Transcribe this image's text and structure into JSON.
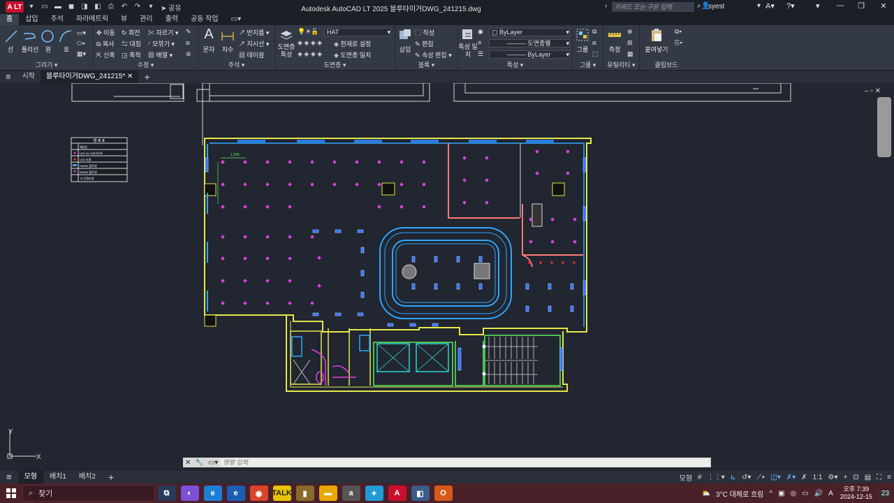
{
  "titlebar": {
    "logo_text": "A LT",
    "share_label": "공유",
    "title": "Autodesk AutoCAD LT 2025   블루타이거DWG_241215.dwg",
    "search_placeholder": "키워드 또는 구문 입력",
    "user": "syest"
  },
  "ribbon_tabs": [
    "홈",
    "삽입",
    "주석",
    "파라메트릭",
    "뷰",
    "관리",
    "출력",
    "공동 작업"
  ],
  "ribbon": {
    "draw": {
      "title": "그리기",
      "line": "선",
      "polyline": "폴리선",
      "circle": "원",
      "arc": "호"
    },
    "modify": {
      "title": "수정",
      "move": "이동",
      "rotate": "회전",
      "trim": "자르기",
      "copy": "복사",
      "mirror": "대칭",
      "fillet": "모깎기",
      "stretch": "신축",
      "scale": "축척",
      "array": "배열"
    },
    "annotation": {
      "title": "주석",
      "text": "문자",
      "dimension": "치수",
      "leader": "지시선",
      "multileader": "반지름",
      "table": "테이블"
    },
    "layers": {
      "title": "도면층",
      "properties": "도면층 특성",
      "current_layer": "HAT",
      "set_current": "현재로 설정",
      "match": "도면층 일치"
    },
    "block": {
      "title": "블록",
      "insert": "삽입",
      "create": "작성",
      "edit": "편집",
      "attr_edit": "속성 편집"
    },
    "properties": {
      "title": "특성",
      "match": "특성 일치",
      "color": "ByLayer",
      "linetype": "도면층별",
      "lineweight": "ByLayer"
    },
    "groups": {
      "title": "그룹",
      "group": "그룹"
    },
    "utilities": {
      "title": "유틸리티",
      "measure": "측정"
    },
    "clipboard": {
      "title": "클립보드",
      "paste": "붙여넣기"
    }
  },
  "doc_tabs": {
    "start": "시작",
    "current": "블루타이거DWG_241215*"
  },
  "drawing": {
    "legend_title": "범 례 표",
    "legend_items": [
      "매입등",
      "LED 3w 다운라이트",
      "LED 조명",
      "PAR20 할로겐",
      "PAR30 할로겐",
      "T5 간접조명"
    ],
    "dim_label": "1,200"
  },
  "command": {
    "placeholder": "명령 입력"
  },
  "layout_tabs": [
    "모형",
    "배치1",
    "배치2"
  ],
  "status": {
    "model": "모형",
    "scale": "1:1"
  },
  "taskbar": {
    "search": "찾기",
    "weather": "3°C  대체로 흐림",
    "lang": "A",
    "time": "오후 7:39",
    "date": "2024-12-15",
    "notifications": "23"
  },
  "colors": {
    "accent": "#6fb3ff",
    "taskbar": "#4a2029",
    "canvas": "#212630"
  }
}
